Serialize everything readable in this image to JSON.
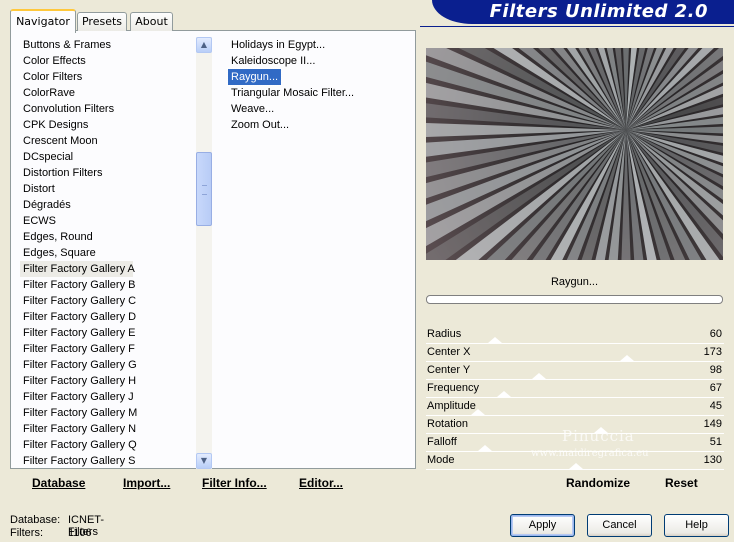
{
  "header": {
    "title": "Filters Unlimited 2.0"
  },
  "tabs": [
    {
      "label": "Navigator",
      "active": true
    },
    {
      "label": "Presets",
      "active": false
    },
    {
      "label": "About",
      "active": false
    }
  ],
  "categories": {
    "selected": "Filter Factory Gallery A",
    "items": [
      "Buttons & Frames",
      "Color Effects",
      "Color Filters",
      "ColorRave",
      "Convolution Filters",
      "CPK Designs",
      "Crescent Moon",
      "DCspecial",
      "Distortion Filters",
      "Distort",
      "Dégradés",
      "ECWS",
      "Edges, Round",
      "Edges, Square",
      "Filter Factory Gallery A",
      "Filter Factory Gallery B",
      "Filter Factory Gallery C",
      "Filter Factory Gallery D",
      "Filter Factory Gallery E",
      "Filter Factory Gallery F",
      "Filter Factory Gallery G",
      "Filter Factory Gallery H",
      "Filter Factory Gallery J",
      "Filter Factory Gallery M",
      "Filter Factory Gallery N",
      "Filter Factory Gallery Q",
      "Filter Factory Gallery S"
    ]
  },
  "filters": {
    "selected": "Raygun...",
    "items": [
      "Holidays in Egypt...",
      "Kaleidoscope II...",
      "Raygun...",
      "Triangular Mosaic Filter...",
      "Weave...",
      "Zoom Out..."
    ]
  },
  "preview": {
    "filter_name": "Raygun..."
  },
  "params": [
    {
      "label": "Radius",
      "value": 60
    },
    {
      "label": "Center X",
      "value": 173
    },
    {
      "label": "Center Y",
      "value": 98
    },
    {
      "label": "Frequency",
      "value": 67
    },
    {
      "label": "Amplitude",
      "value": 45
    },
    {
      "label": "Rotation",
      "value": 149
    },
    {
      "label": "Falloff",
      "value": 51
    },
    {
      "label": "Mode",
      "value": 130
    }
  ],
  "left_buttons": {
    "database": "Database",
    "import": "Import...",
    "filter_info": "Filter Info...",
    "editor": "Editor..."
  },
  "right_buttons": {
    "randomize": "Randomize",
    "reset": "Reset"
  },
  "status": {
    "database_label": "Database:",
    "database_value": "ICNET-Filters",
    "filters_label": "Filters:",
    "filters_value": "1106"
  },
  "dialog_buttons": {
    "apply": "Apply",
    "cancel": "Cancel",
    "help": "Help"
  },
  "watermark": {
    "name": "Pinuccia",
    "url": "www.maidiregrafica.eu"
  },
  "icons": {
    "scroll_up": "scroll-up-arrow-icon",
    "scroll_down": "scroll-down-arrow-icon"
  },
  "colors": {
    "banner": "#0a1f8f",
    "selection": "#316ac5",
    "tab_highlight": "#ffc83c"
  }
}
